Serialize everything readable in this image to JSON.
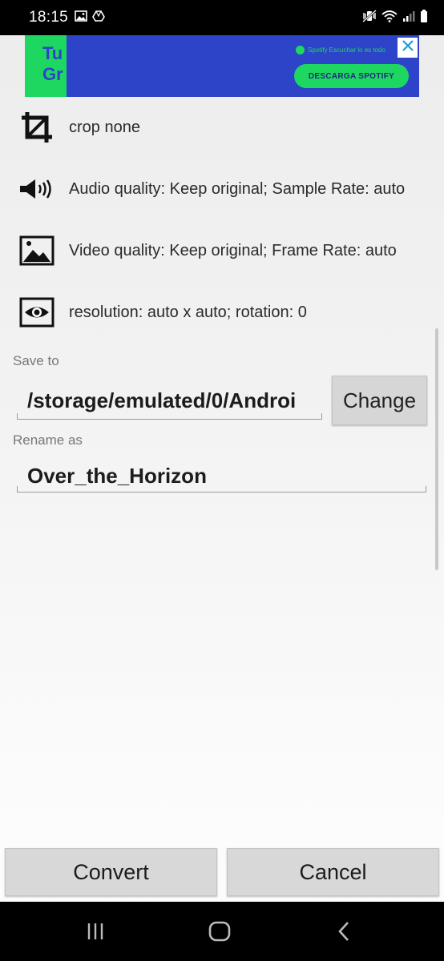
{
  "status_bar": {
    "time": "18:15",
    "left_icons": [
      "image-icon",
      "drive-icon"
    ],
    "right_icons": [
      "mute-vibrate-icon",
      "wifi-icon",
      "signal-icon",
      "battery-icon"
    ]
  },
  "ad": {
    "green_text": "Tu\nGr",
    "sponsor_line": "Spotify  Escuchar lo es todo",
    "cta_label": "DESCARGA SPOTIFY",
    "colors": {
      "background": "#2d44c8",
      "accent": "#1ed760"
    }
  },
  "settings": [
    {
      "icon": "crop-icon",
      "label": "crop none"
    },
    {
      "icon": "speaker-icon",
      "label": "Audio quality: Keep original; Sample Rate: auto"
    },
    {
      "icon": "image-icon",
      "label": "Video quality: Keep original; Frame Rate: auto"
    },
    {
      "icon": "eye-icon",
      "label": "resolution: auto x auto; rotation: 0"
    }
  ],
  "save_to": {
    "label": "Save to",
    "path": "/storage/emulated/0/Androi",
    "change_label": "Change"
  },
  "rename": {
    "label": "Rename as",
    "value": "Over_the_Horizon"
  },
  "actions": {
    "convert_label": "Convert",
    "cancel_label": "Cancel"
  },
  "nav": [
    "recent-apps-icon",
    "home-icon",
    "back-icon"
  ]
}
